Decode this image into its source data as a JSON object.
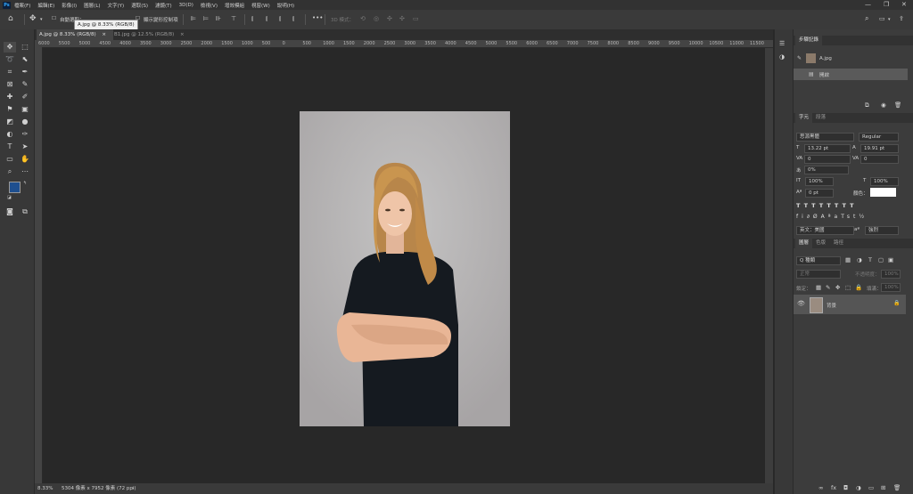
{
  "app": {
    "logo": "Ps"
  },
  "menu": [
    "檔案(F)",
    "編輯(E)",
    "影像(I)",
    "圖層(L)",
    "文字(Y)",
    "選取(S)",
    "濾鏡(T)",
    "3D(D)",
    "檢視(V)",
    "增效模組",
    "視窗(W)",
    "說明(H)"
  ],
  "options": {
    "auto_select_label": "自動選取：",
    "transform_label": "顯示變形控制項",
    "mode_3d_label": "3D 模式：",
    "more": "•••"
  },
  "tooltip": "A.jpg @ 8.33% (RGB/8)",
  "tabs": [
    {
      "label": "A.jpg @ 8.33% (RGB/8)",
      "close": "×"
    },
    {
      "label": "B1.jpg @ 12.5% (RGB/8)",
      "close": "×"
    }
  ],
  "ruler_ticks": [
    "6000",
    "5500",
    "5000",
    "4500",
    "4000",
    "3500",
    "3000",
    "2500",
    "2000",
    "1500",
    "1000",
    "500",
    "0",
    "500",
    "1000",
    "1500",
    "2000",
    "2500",
    "3000",
    "3500",
    "4000",
    "4500",
    "5000",
    "5500",
    "6000",
    "6500",
    "7000",
    "7500",
    "8000",
    "8500",
    "9000",
    "9500",
    "10000",
    "10500",
    "11000",
    "11500"
  ],
  "status": {
    "zoom": "8.33%",
    "doc_info": "5304 像素 x 7952 像素 (72 ppi)",
    "arrow": "›"
  },
  "history": {
    "title": "步驟記錄",
    "snapshot": "A.jpg",
    "step": "開啟"
  },
  "character": {
    "tab_char": "字元",
    "tab_para": "段落",
    "font_family": "思源黑體",
    "font_style": "Regular",
    "font_size": "13.22 pt",
    "leading": "19.91 pt",
    "kerning": "0",
    "tracking": "0",
    "tsume": "0%",
    "vscale": "100%",
    "hscale": "100%",
    "baseline": "0 pt",
    "color_label": "顏色：",
    "language": "英文：美國",
    "antialias": "強烈"
  },
  "layers": {
    "tab_layers": "圖層",
    "tab_channels": "色版",
    "tab_paths": "路徑",
    "filter": "Q 種類",
    "blend": "正常",
    "opacity_label": "不透明度：",
    "opacity": "100%",
    "lock_label": "鎖定：",
    "fill_label": "填滿：",
    "fill": "100%",
    "layer_name": "背景"
  },
  "colors": {
    "foreground": "#1e4f8f",
    "background": "#ffffff",
    "accent": "#31a8ff"
  }
}
